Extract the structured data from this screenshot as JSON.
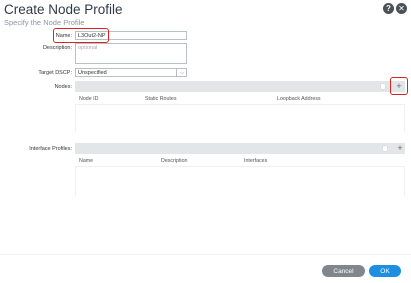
{
  "header": {
    "title": "Create Node Profile",
    "subtitle": "Specify the Node Profile",
    "help_icon": "question-circle-icon",
    "close_icon": "close-circle-icon"
  },
  "form": {
    "name": {
      "label": "Name:",
      "value": "L3Out2-NP"
    },
    "description": {
      "label": "Description:",
      "placeholder": "optional"
    },
    "target_dscp": {
      "label": "Target DSCP:",
      "value": "Unspecified"
    },
    "nodes": {
      "label": "Nodes:",
      "columns": [
        "Node ID",
        "Static Routes",
        "Loopback Address"
      ],
      "add_symbol": "+"
    },
    "interface_profiles": {
      "label": "Interface Profiles:",
      "columns": [
        "Name",
        "Description",
        "Interfaces"
      ],
      "add_symbol": "+"
    }
  },
  "footer": {
    "cancel_label": "Cancel",
    "ok_label": "OK"
  },
  "colors": {
    "highlight": "#d9231e",
    "primary_button": "#1e8fe0",
    "secondary_button": "#7f868c",
    "table_bar": "#e3e6e8"
  }
}
